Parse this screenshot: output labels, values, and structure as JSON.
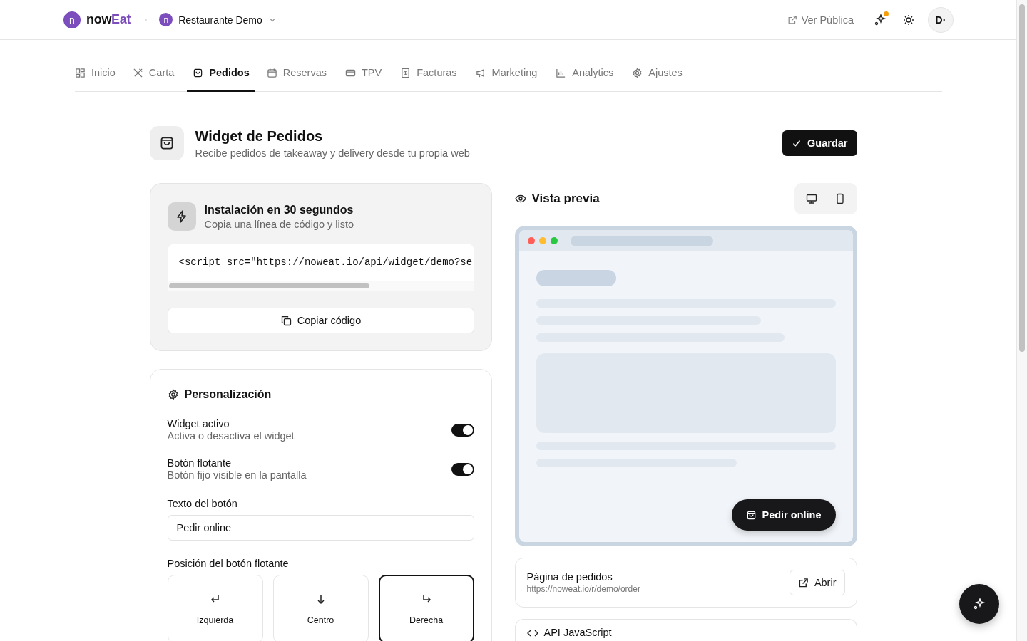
{
  "header": {
    "logo": {
      "mark": "n",
      "name": "now",
      "accent": "Eat"
    },
    "restaurant": {
      "mark": "n",
      "name": "Restaurante Demo"
    },
    "public_link": "Ver Pública",
    "has_notification": true,
    "avatar": "D·"
  },
  "tabs": [
    {
      "label": "Inicio",
      "selected": false
    },
    {
      "label": "Carta",
      "selected": false
    },
    {
      "label": "Pedidos",
      "selected": true
    },
    {
      "label": "Reservas",
      "selected": false
    },
    {
      "label": "TPV",
      "selected": false
    },
    {
      "label": "Facturas",
      "selected": false
    },
    {
      "label": "Marketing",
      "selected": false
    },
    {
      "label": "Analytics",
      "selected": false
    },
    {
      "label": "Ajustes",
      "selected": false
    }
  ],
  "page": {
    "title": "Widget de Pedidos",
    "subtitle": "Recibe pedidos de takeaway y delivery desde tu propia web",
    "save_button": "Guardar"
  },
  "install": {
    "title": "Instalación en 30 segundos",
    "subtitle": "Copia una línea de código y listo",
    "code": "<script src=\"https://noweat.io/api/widget/demo?se",
    "copy_button": "Copiar código"
  },
  "customization": {
    "title": "Personalización",
    "toggles": [
      {
        "label": "Widget activo",
        "description": "Activa o desactiva el widget",
        "on": true
      },
      {
        "label": "Botón flotante",
        "description": "Botón fijo visible en la pantalla",
        "on": true
      }
    ],
    "button_text": {
      "label": "Texto del botón",
      "value": "Pedir online"
    },
    "position_label": "Posición del botón flotante",
    "positions": [
      {
        "label": "Izquierda",
        "selected": false
      },
      {
        "label": "Centro",
        "selected": false
      },
      {
        "label": "Derecha",
        "selected": true
      }
    ]
  },
  "preview": {
    "title": "Vista previa",
    "button": "Pedir online"
  },
  "order_page": {
    "title": "Página de pedidos",
    "url": "https://noweat.io/r/demo/order",
    "open_button": "Abrir"
  },
  "api": {
    "title": "API JavaScript"
  }
}
